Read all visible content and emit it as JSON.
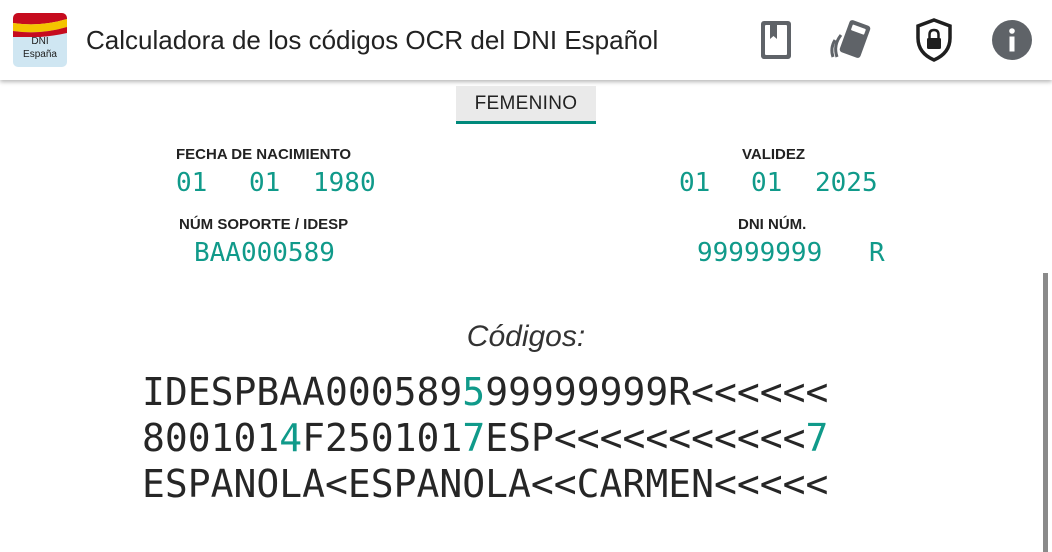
{
  "app": {
    "logo_line1": "DNI",
    "logo_line2": "España",
    "title": "Calculadora de los códigos OCR del DNI Español"
  },
  "toolbar": {
    "icons": [
      "book-icon",
      "card-scan-icon",
      "shield-lock-icon",
      "info-icon"
    ]
  },
  "gender_tab": {
    "label": "FEMENINO"
  },
  "fields": {
    "birth": {
      "label": "FECHA DE NACIMIENTO",
      "day": "01",
      "month": "01",
      "year": "1980"
    },
    "validity": {
      "label": "VALIDEZ",
      "day": "01",
      "month": "01",
      "year": "2025"
    },
    "support": {
      "label": "NÚM SOPORTE / IDESP",
      "value": "BAA000589"
    },
    "dni": {
      "label": "DNI NÚM.",
      "number": "99999999",
      "letter": "R"
    }
  },
  "codes": {
    "title": "Códigos:",
    "line1": {
      "part1": "IDESPBAA000589",
      "check": "5",
      "part2": "99999999R<<<<<<"
    },
    "line2": {
      "part1": "800101",
      "check1": "4",
      "part2": "F250101",
      "check2": "7",
      "part3": "ESP<<<<<<<<<<<",
      "check3": "7"
    },
    "line3": "ESPANOLA<ESPANOLA<<CARMEN<<<<<"
  },
  "colors": {
    "accent": "#109a8a",
    "tab_underline": "#00897b",
    "text": "#222222"
  }
}
